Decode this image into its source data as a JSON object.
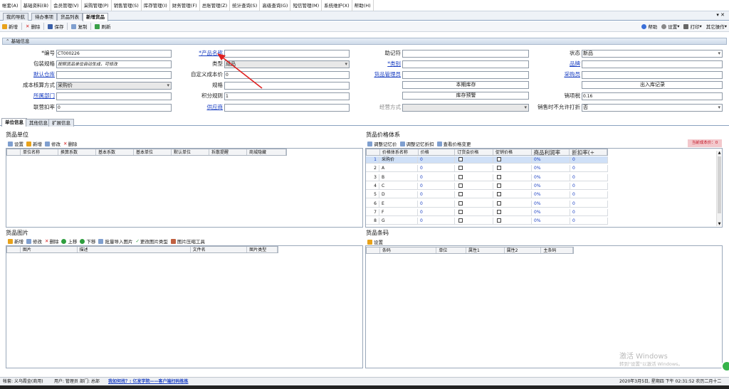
{
  "menu": [
    "帐套(A)",
    "基础资料(B)",
    "会员管理(V)",
    "采购管理(P)",
    "销售管理(S)",
    "库存管理(I)",
    "财务管理(F)",
    "总账管理(Z)",
    "统计查询(S)",
    "高级查询(G)",
    "短信管理(M)",
    "系统维护(X)",
    "帮助(H)"
  ],
  "tabs": [
    "我的导航",
    "待办事项",
    "货品列表",
    "新增货品"
  ],
  "toolbar": {
    "new": "新增",
    "delete": "删除",
    "save": "保存",
    "copy": "复制",
    "refresh": "刷新",
    "help": "帮助",
    "settings": "设置",
    "print": "打印",
    "other": "其它操作"
  },
  "section_title": "基础信息",
  "form": {
    "code_label": "*编号",
    "code_value": "CT000226",
    "product_name_label": "*产品名称",
    "product_name_value": "",
    "mnemonic_label": "助记符",
    "mnemonic_value": "",
    "status_label": "状态",
    "status_value": "新品",
    "pack_label": "包装规格",
    "pack_value": "按照货品单位自动生成，可修改",
    "type_label": "类型",
    "type_value": "成品",
    "category_label": "*类别",
    "category_value": "",
    "brand_label": "品牌",
    "brand_value": "",
    "warehouse_label": "默认仓库",
    "warehouse_value": "",
    "custom_cost_label": "自定义成本价",
    "custom_cost_value": "0",
    "goods_admin_label": "货品管理员",
    "goods_admin_value": "",
    "buyer_label": "采购员",
    "buyer_value": "",
    "cost_method_label": "成本核算方式",
    "cost_method_value": "采购价",
    "spec_label": "规格",
    "spec_value": "",
    "this_period_btn": "本期库存",
    "inout_btn": "出入库记录",
    "dept_label": "所属部门",
    "dept_value": "",
    "points_label": "积分规则",
    "points_value": "1",
    "stock_alert_btn": "库存预警",
    "tax_label": "销项税",
    "tax_value": "0.16",
    "joint_label": "联营扣率",
    "joint_value": "0",
    "supplier_label": "供应商",
    "supplier_value": "",
    "operation_label": "经营方式",
    "operation_value": "",
    "no_discount_label": "销售时不允许打折",
    "no_discount_value": "否"
  },
  "subtabs": [
    "单位信息",
    "其他信息",
    "扩展信息"
  ],
  "unit_panel": {
    "title": "货品单位",
    "tools": [
      "设置",
      "新增",
      "修改",
      "删除"
    ],
    "columns": [
      "单位名称",
      "换算系数",
      "基本系数",
      "基本单位",
      "默认单位",
      "拆散提醒",
      "商城隐藏"
    ]
  },
  "price_panel": {
    "title": "货品价格体系",
    "tools": [
      "调整记忆价",
      "调整记忆折扣",
      "查看价格变更"
    ],
    "current_cost": "当前成本价：0",
    "columns": [
      "价格体系名称",
      "价格",
      "订货会价格",
      "促销价格",
      "商品利润率",
      "折扣率(÷"
    ],
    "rows": [
      {
        "n": "1",
        "name": "采购价",
        "price": "0",
        "profit": "0%",
        "discount": "0"
      },
      {
        "n": "2",
        "name": "A",
        "price": "0",
        "profit": "0%",
        "discount": "0"
      },
      {
        "n": "3",
        "name": "B",
        "price": "0",
        "profit": "0%",
        "discount": "0"
      },
      {
        "n": "4",
        "name": "C",
        "price": "0",
        "profit": "0%",
        "discount": "0"
      },
      {
        "n": "5",
        "name": "D",
        "price": "0",
        "profit": "0%",
        "discount": "0"
      },
      {
        "n": "6",
        "name": "E",
        "price": "0",
        "profit": "0%",
        "discount": "0"
      },
      {
        "n": "7",
        "name": "F",
        "price": "0",
        "profit": "0%",
        "discount": "0"
      },
      {
        "n": "8",
        "name": "G",
        "price": "0",
        "profit": "0%",
        "discount": "0"
      }
    ]
  },
  "image_panel": {
    "title": "货品图片",
    "tools": [
      "新增",
      "修改",
      "删除",
      "上移",
      "下移",
      "批量导入图片",
      "更改图片类型",
      "图片压缩工具"
    ],
    "columns": [
      "图片",
      "描述",
      "文件名",
      "图片类型"
    ]
  },
  "barcode_panel": {
    "title": "货品条码",
    "tools": [
      "设置"
    ],
    "columns": [
      "条码",
      "单位",
      "属性1",
      "属性2",
      "主条码"
    ]
  },
  "watermark": {
    "line1": "激活 Windows",
    "line2": "转到\"设置\"以激活 Windows。"
  },
  "status": {
    "account": "帐套: 义乌霞金(商用)",
    "user": "用户: 管理员",
    "dept": "部门: 总部",
    "promo": "我如何找？: 亿发学院——客户端扫码练练",
    "datetime": "2020年3月5日, 星期四 下午 02:31:52 农历二月十二"
  },
  "colors": {
    "accent": "#1a3fc2",
    "arrow": "#e02020",
    "header": "#cfdbea"
  }
}
